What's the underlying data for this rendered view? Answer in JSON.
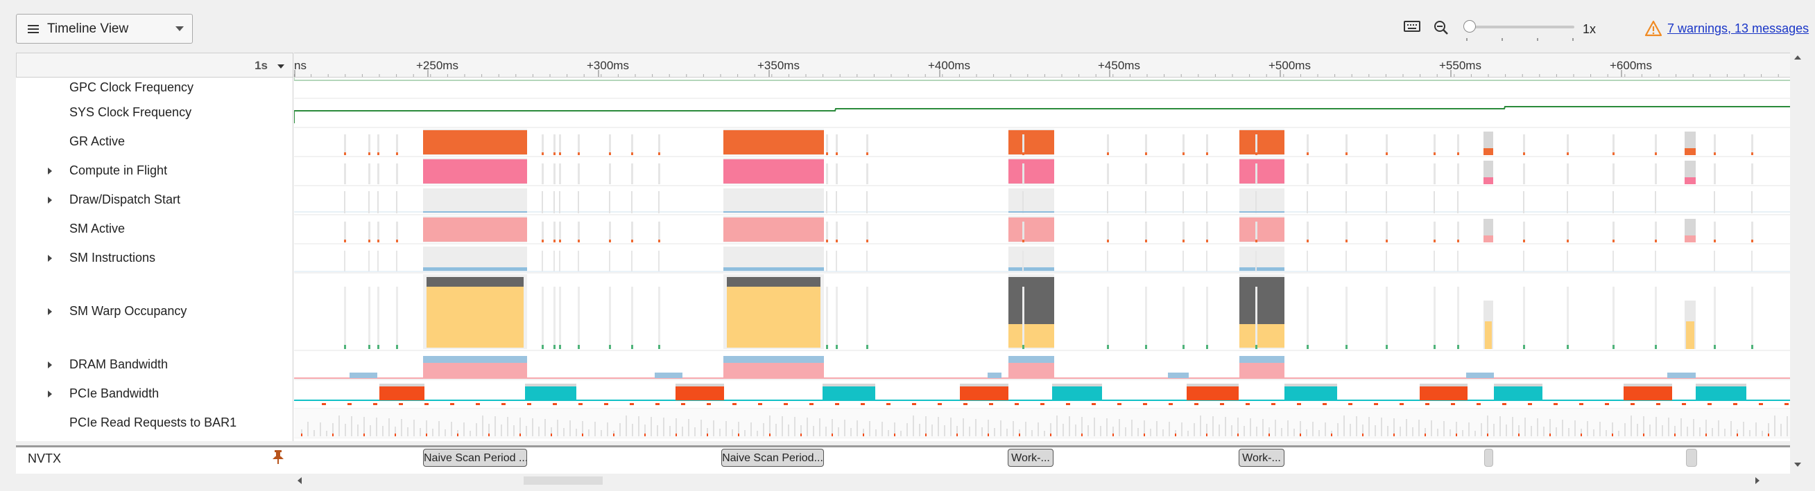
{
  "toolbar": {
    "view_select_label": "Timeline View",
    "zoom_level": "1x",
    "warnings_link": "7 warnings, 13 messages",
    "zoom_slider_value": 0.0
  },
  "timeline": {
    "range_label": "1s",
    "ruler_ticks": [
      "ns",
      "+250ms",
      "+300ms",
      "+350ms",
      "+400ms",
      "+450ms",
      "+500ms",
      "+550ms",
      "+600ms"
    ]
  },
  "rows": [
    {
      "label": "GPC Clock Frequency",
      "expandable": false
    },
    {
      "label": "SYS Clock Frequency",
      "expandable": false
    },
    {
      "label": "GR Active",
      "expandable": false
    },
    {
      "label": "Compute in Flight",
      "expandable": true
    },
    {
      "label": "Draw/Dispatch Start",
      "expandable": true
    },
    {
      "label": "SM Active",
      "expandable": false
    },
    {
      "label": "SM Instructions",
      "expandable": true
    },
    {
      "label": "SM Warp Occupancy",
      "expandable": true
    },
    {
      "label": "DRAM Bandwidth",
      "expandable": true
    },
    {
      "label": "PCIe Bandwidth",
      "expandable": true
    },
    {
      "label": "PCIe Read Requests to BAR1",
      "expandable": false
    }
  ],
  "nvtx": {
    "label": "NVTX",
    "ranges": [
      "Naive Scan Period ...",
      "Naive Scan Period...",
      "Work-...",
      "Work-..."
    ]
  },
  "colors": {
    "gr_active": "#ef6a32",
    "compute": "#f7799a",
    "sm_active": "#f7a4a6",
    "sm_instructions": "#8fbede",
    "warp_fill": "#fdd17a",
    "warp_idle": "#666666",
    "dram_read": "#9bc3df",
    "dram_write": "#f7a9ae",
    "pcie_h2d": "#f24d1b",
    "pcie_d2h": "#13c1c6",
    "clock_line": "#2a8a3a",
    "link": "#1a36c7",
    "warning": "#f08a22"
  }
}
